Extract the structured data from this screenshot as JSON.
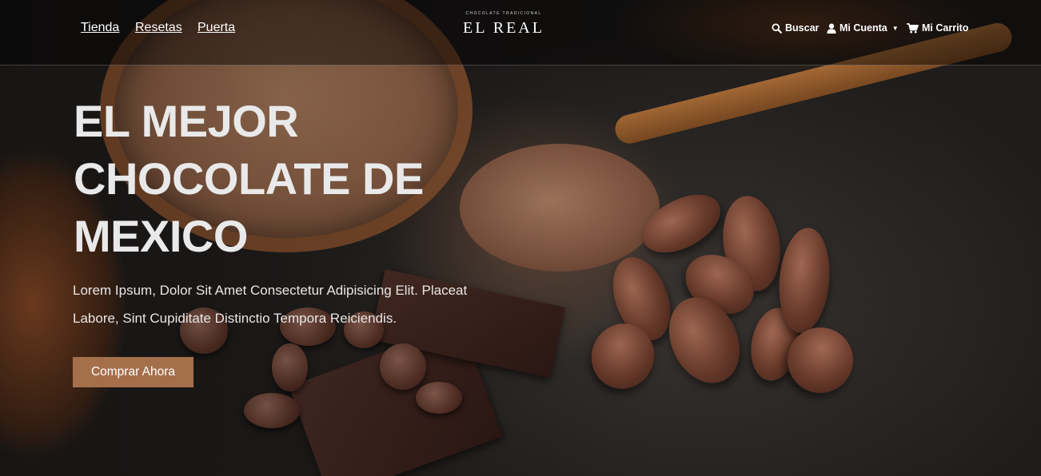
{
  "nav": {
    "links": [
      "Tienda",
      "Resetas",
      "Puerta"
    ]
  },
  "brand": {
    "tagline": "CHOCOLATE TRADICIONAL",
    "name": "EL REAL"
  },
  "utility": {
    "search_label": "Buscar",
    "search_icon": "search-icon",
    "account_label": "Mi Cuenta",
    "account_icon": "user-icon",
    "cart_label": "Mi Carrito",
    "cart_icon": "cart-icon"
  },
  "hero": {
    "headline_lines": [
      "EL MEJOR",
      "CHOCOLATE DE",
      "MEXICO"
    ],
    "tagline_lines": [
      "Lorem Ipsum, Dolor Sit Amet Consectetur Adipisicing Elit. Placeat",
      "Labore, Sint Cupiditate Distinctio Tempora Reiciendis."
    ],
    "cta_label": "Comprar Ahora"
  },
  "colors": {
    "accent": "#a56f4b",
    "headline": "#e9e9ea"
  }
}
